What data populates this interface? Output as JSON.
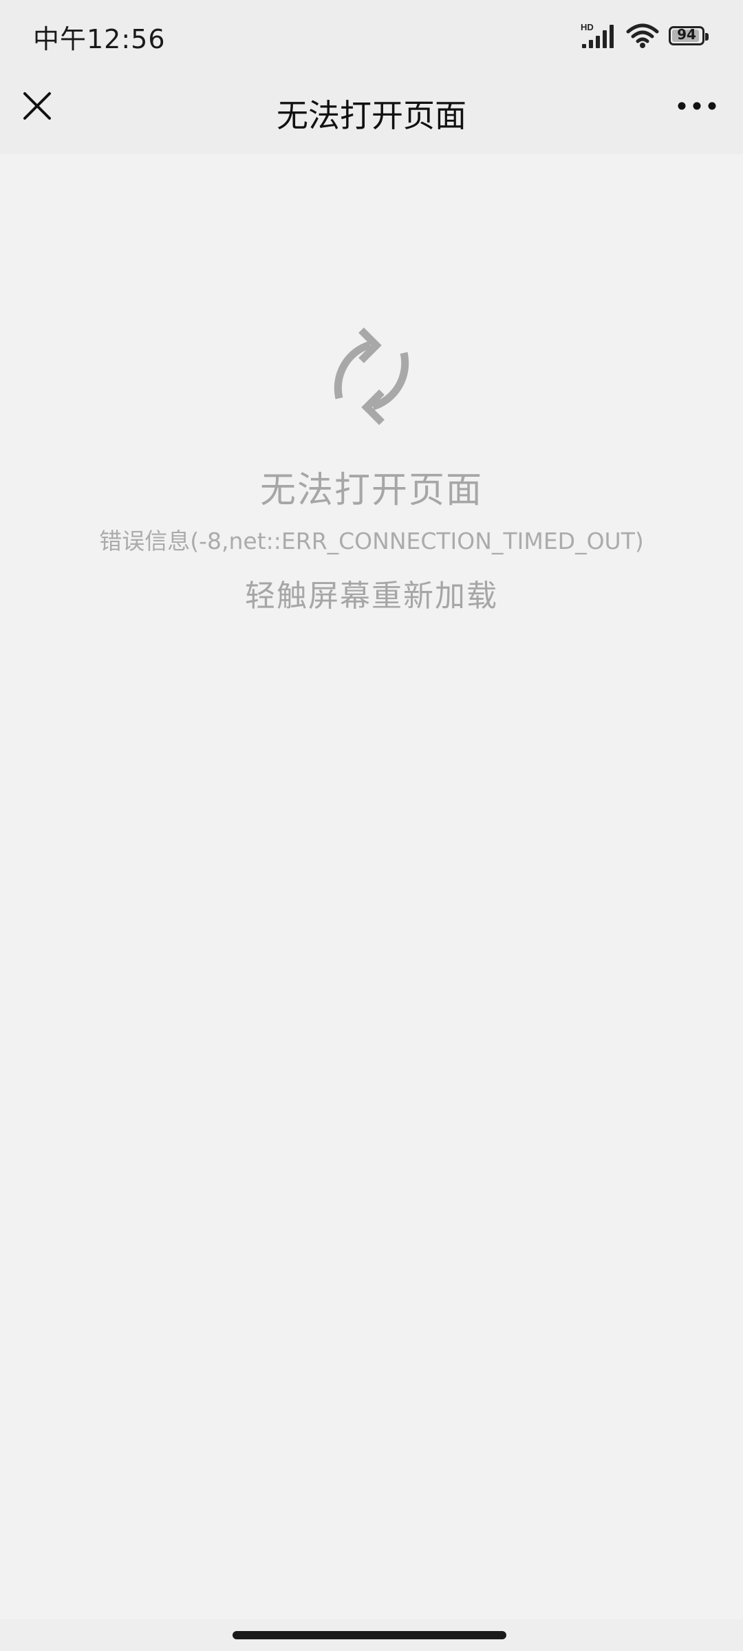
{
  "status_bar": {
    "time": "中午12:56",
    "network_label": "HD",
    "battery_level": "94",
    "battery_fraction": 0.94,
    "icons": [
      "hd-signal-icon",
      "wifi-icon",
      "battery-icon"
    ]
  },
  "nav": {
    "title": "无法打开页面",
    "close_icon": "close-icon",
    "more_icon": "more-dots-icon"
  },
  "error": {
    "icon": "reload-icon",
    "title": "无法打开页面",
    "detail": "错误信息(-8,net::ERR_CONNECTION_TIMED_OUT)",
    "reload_hint": "轻触屏幕重新加载"
  },
  "colors": {
    "background": "#f2f2f2",
    "header": "#ededed",
    "muted_text": "#a6a6a6",
    "icon_gray": "#a8a8a8"
  }
}
